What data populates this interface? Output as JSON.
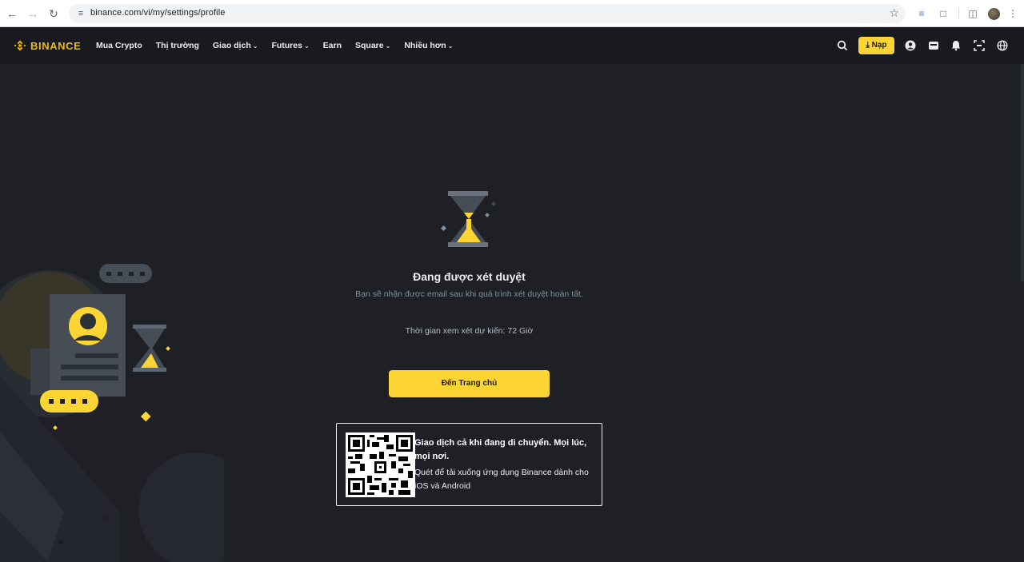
{
  "browser": {
    "url": "binance.com/vi/my/settings/profile",
    "icons": {
      "back": "arrow-left-icon",
      "forward": "arrow-right-icon",
      "reload": "reload-icon",
      "site_info": "tune-icon",
      "bookmark": "star-icon",
      "extensions": [
        "translate-icon",
        "puzzle-icon",
        "side-panel-icon"
      ],
      "menu": "kebab-menu-icon"
    }
  },
  "header": {
    "logo_text": "BINANCE",
    "menu": [
      {
        "label": "Mua Crypto",
        "has_dropdown": false
      },
      {
        "label": "Thị trường",
        "has_dropdown": false
      },
      {
        "label": "Giao dịch",
        "has_dropdown": true
      },
      {
        "label": "Futures",
        "has_dropdown": true
      },
      {
        "label": "Earn",
        "has_dropdown": false
      },
      {
        "label": "Square",
        "has_dropdown": true
      },
      {
        "label": "Nhiều hơn",
        "has_dropdown": true
      }
    ],
    "deposit_label": "Nạp",
    "icons": [
      "search-icon",
      "user-icon",
      "wallet-icon",
      "bell-icon",
      "download-qr-icon",
      "globe-icon"
    ]
  },
  "review": {
    "title": "Đang được xét duyệt",
    "subtitle": "Bạn sẽ nhận được email sau khi quá trình xét duyệt hoàn tất.",
    "review_time": "Thời gian xem xét dự kiến: 72 Giờ",
    "home_button": "Đến Trang chủ"
  },
  "app_promo": {
    "title": "Giao dịch cả khi đang di chuyển. Mọi lúc, mọi nơi.",
    "description": "Quét để tải xuống ứng dụng Binance dành cho iOS và Android"
  },
  "colors": {
    "brand_yellow": "#fcd535",
    "logo_yellow": "#f0b90b",
    "page_bg": "#1e2026",
    "header_bg": "#181a20"
  }
}
